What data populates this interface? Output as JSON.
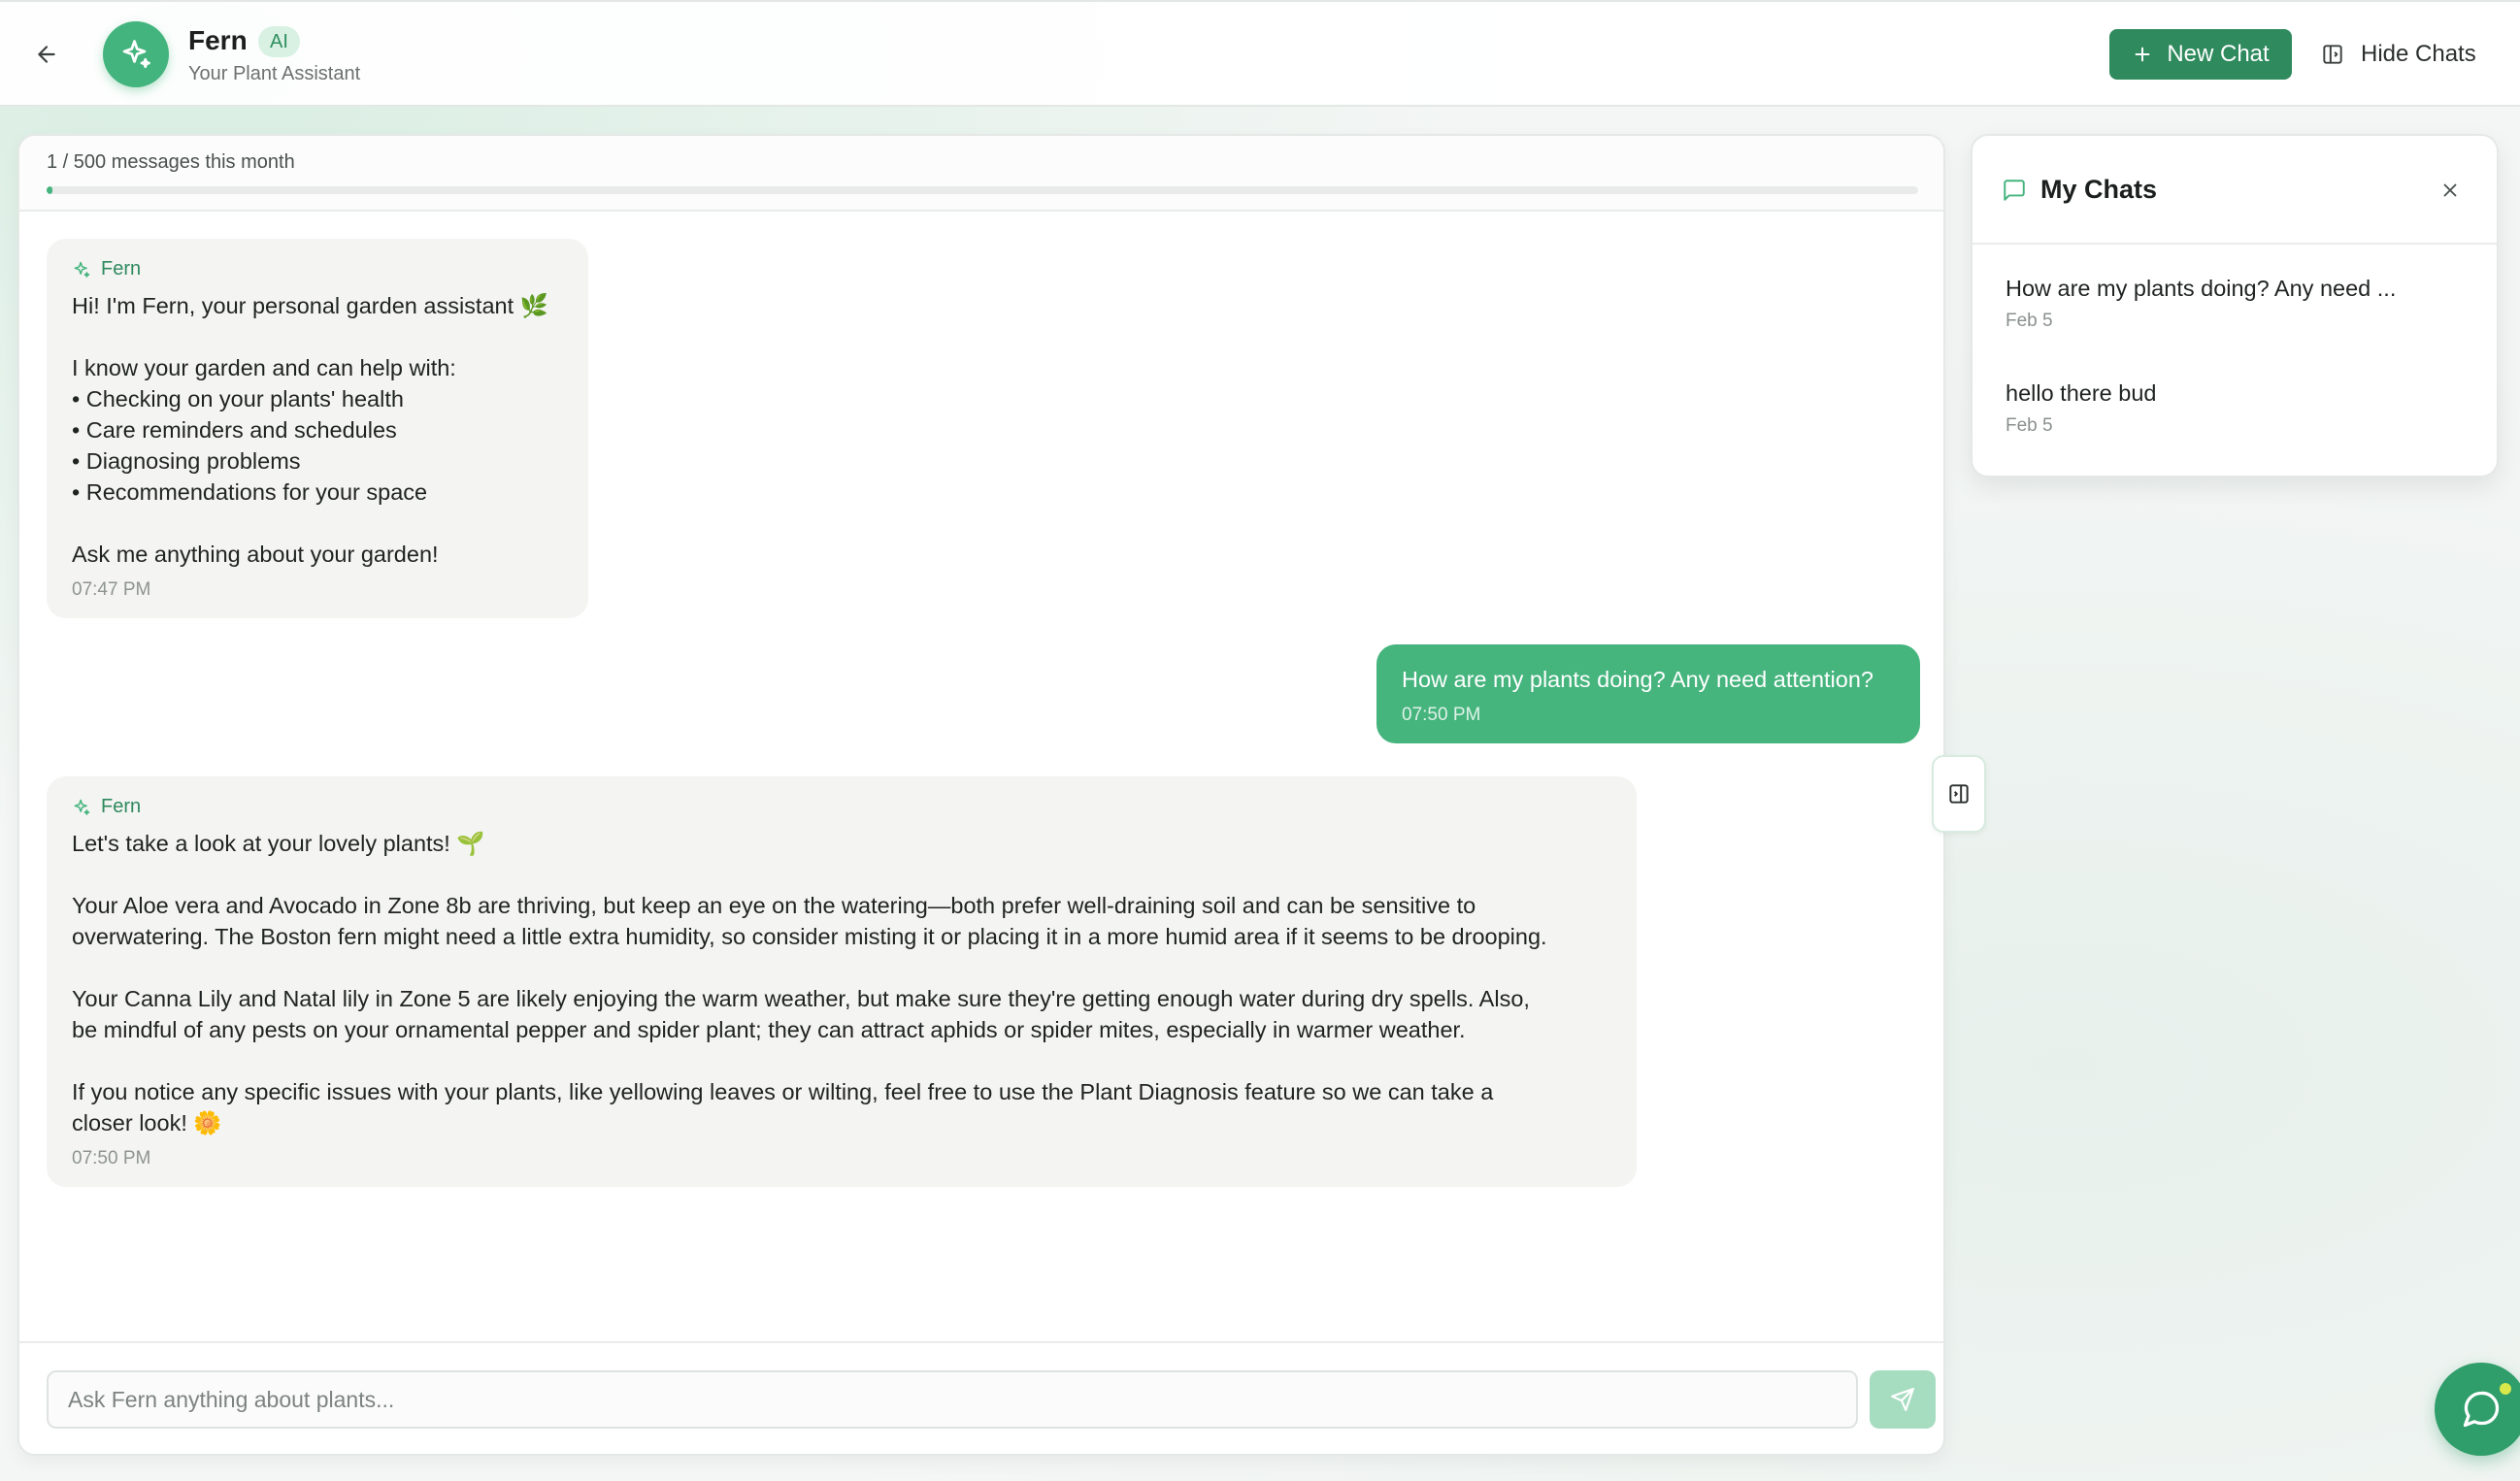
{
  "header": {
    "assistant_name": "Fern",
    "badge": "AI",
    "subtitle": "Your Plant Assistant",
    "new_chat_label": "New Chat",
    "hide_chats_label": "Hide Chats"
  },
  "usage": {
    "text": "1 / 500 messages this month",
    "used": 1,
    "limit": 500
  },
  "messages": [
    {
      "sender": "Fern",
      "text": "Hi! I'm Fern, your personal garden assistant 🌿\n\nI know your garden and can help with:\n• Checking on your plants' health\n• Care reminders and schedules\n• Diagnosing problems\n• Recommendations for your space\n\nAsk me anything about your garden!",
      "time": "07:47 PM"
    },
    {
      "text": "How are my plants doing? Any need attention?",
      "time": "07:50 PM"
    },
    {
      "sender": "Fern",
      "text": "Let's take a look at your lovely plants! 🌱\n\nYour Aloe vera and Avocado in Zone 8b are thriving, but keep an eye on the watering—both prefer well-draining soil and can be sensitive to\noverwatering. The Boston fern might need a little extra humidity, so consider misting it or placing it in a more humid area if it seems to be drooping.\n\nYour Canna Lily and Natal lily in Zone 5 are likely enjoying the warm weather, but make sure they're getting enough water during dry spells. Also,\nbe mindful of any pests on your ornamental pepper and spider plant; they can attract aphids or spider mites, especially in warmer weather.\n\nIf you notice any specific issues with your plants, like yellowing leaves or wilting, feel free to use the Plant Diagnosis feature so we can take a\ncloser look! 🌼",
      "time": "07:50 PM"
    }
  ],
  "composer": {
    "placeholder": "Ask Fern anything about plants..."
  },
  "sidebar": {
    "title": "My Chats",
    "chats": [
      {
        "title": "How are my plants doing? Any need ...",
        "date": "Feb 5"
      },
      {
        "title": "hello there bud",
        "date": "Feb 5"
      }
    ]
  },
  "colors": {
    "accent": "#44b47e",
    "accent_dark": "#2f8a5e",
    "user_bubble": "#45b47d",
    "ai_bubble": "#f4f4f2"
  },
  "icons": {
    "back": "arrow-left-icon",
    "avatar": "sparkles-icon",
    "new_chat": "plus-icon",
    "hide_chats": "panel-icon",
    "chats": "message-square-icon",
    "close": "close-icon",
    "send": "send-icon",
    "fab": "chat-bubble-icon"
  }
}
